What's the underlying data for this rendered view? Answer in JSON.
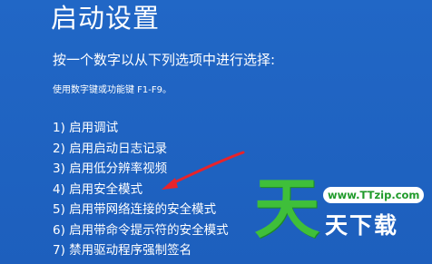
{
  "screen": {
    "title": "启动设置",
    "instruction": "按一个数字以从下列选项中进行选择:",
    "hint": "使用数字键或功能键 F1-F9。",
    "options": [
      {
        "label": "1) 启用调试"
      },
      {
        "label": "2) 启用启动日志记录"
      },
      {
        "label": "3) 启用低分辨率视频"
      },
      {
        "label": "4) 启用安全模式"
      },
      {
        "label": "5) 启用带网络连接的安全模式"
      },
      {
        "label": "6) 启用带命令提示符的安全模式"
      },
      {
        "label": "7) 禁用驱动程序强制签名"
      }
    ]
  },
  "annotation": {
    "arrow_color": "#e8232a",
    "arrow_target": "4) 启用安全模式"
  },
  "watermark": {
    "logo_char": "天",
    "url": "www.TTzip.com",
    "sub_text": "天下载",
    "logo_color": "#3fbf3a"
  },
  "colors": {
    "background": "#1f63c1",
    "text": "#ffffff"
  }
}
